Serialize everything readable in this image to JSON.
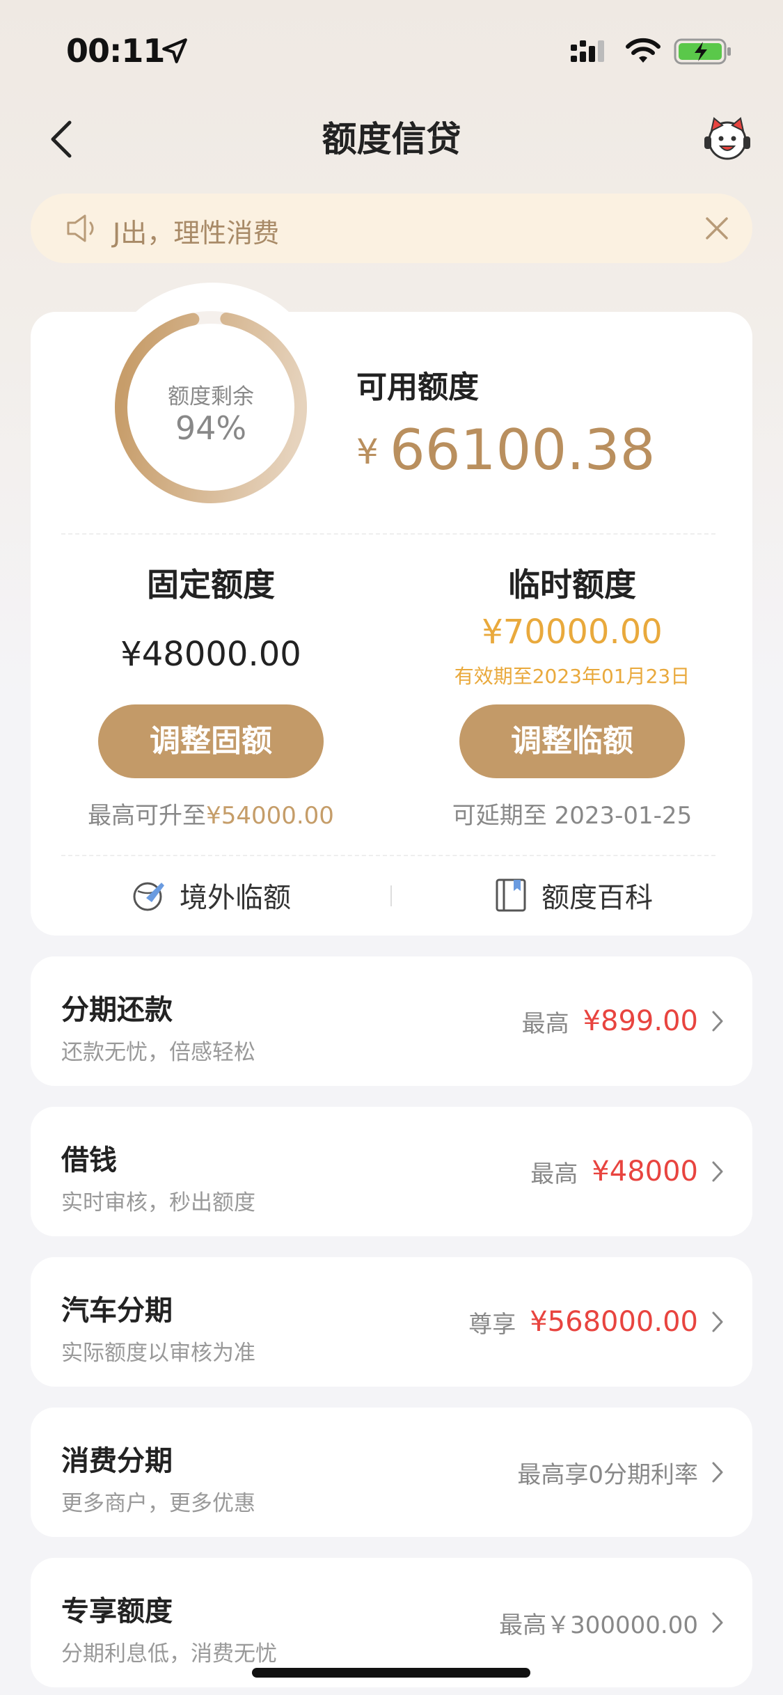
{
  "status_bar": {
    "time": "00:11"
  },
  "nav": {
    "title": "额度信贷"
  },
  "notice": {
    "text": "J出，理性消费"
  },
  "quota": {
    "ring_label": "额度剩余",
    "ring_percent": "94%",
    "ring_fraction": 0.94,
    "available_label": "可用额度",
    "available_currency": "¥",
    "available_amount": "66100.38",
    "fixed": {
      "title": "固定额度",
      "amount": "¥48000.00",
      "button": "调整固额",
      "note_prefix": "最高可升至",
      "note_value": "¥54000.00"
    },
    "temporary": {
      "title": "临时额度",
      "amount": "¥70000.00",
      "valid_until": "有效期至2023年01月23日",
      "button": "调整临额",
      "note": "可延期至 2023-01-25"
    },
    "links": {
      "overseas": "境外临额",
      "encyclopedia": "额度百科"
    }
  },
  "services": [
    {
      "title": "分期还款",
      "subtitle": "还款无忧，倍感轻松",
      "prefix": "最高",
      "value": "¥899.00"
    },
    {
      "title": "借钱",
      "subtitle": "实时审核，秒出额度",
      "prefix": "最高",
      "value": "¥48000"
    },
    {
      "title": "汽车分期",
      "subtitle": "实际额度以审核为准",
      "prefix": "尊享",
      "value": "¥568000.00"
    },
    {
      "title": "消费分期",
      "subtitle": "更多商户，更多优惠",
      "plain": "最高享0分期利率"
    },
    {
      "title": "专享额度",
      "subtitle": "分期利息低，消费无忧",
      "plain": "最高￥300000.00"
    }
  ],
  "colors": {
    "gold": "#c39a68",
    "gold_text": "#b98f5e",
    "orange": "#e9a93c",
    "red": "#e8443f",
    "ring_track": "#f5f0ec"
  }
}
